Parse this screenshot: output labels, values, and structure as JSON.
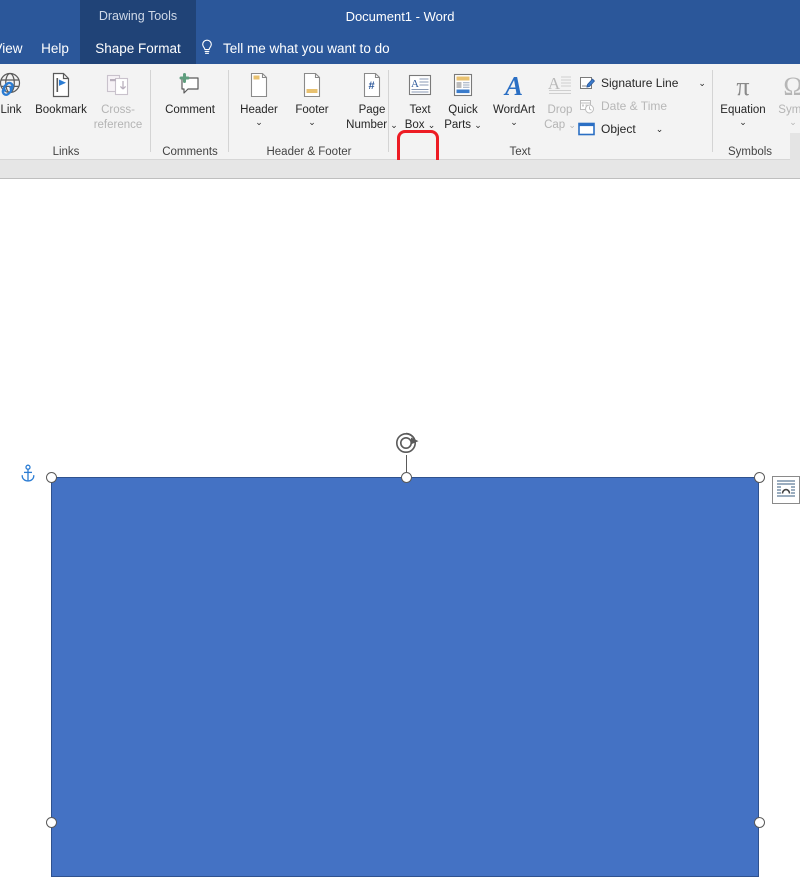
{
  "window": {
    "title": "Document1  -  Word",
    "contextual_tab_header": "Drawing Tools"
  },
  "tabs": [
    {
      "id": "view",
      "label": "View",
      "active": false
    },
    {
      "id": "help",
      "label": "Help",
      "active": false
    },
    {
      "id": "shape-format",
      "label": "Shape Format",
      "active": true
    }
  ],
  "tell_me": {
    "label": "Tell me what you want to do",
    "icon": "lightbulb-icon"
  },
  "ribbon": {
    "groups": [
      {
        "id": "links",
        "label": "Links",
        "buttons": [
          {
            "id": "link",
            "label": "Link",
            "icon": "globe-link-icon",
            "disabled": false
          },
          {
            "id": "bookmark",
            "label": "Bookmark",
            "icon": "bookmark-flag-icon",
            "disabled": false
          },
          {
            "id": "cross-reference",
            "label": "Cross-",
            "label2": "reference",
            "icon": "cross-reference-icon",
            "disabled": true
          }
        ]
      },
      {
        "id": "comments",
        "label": "Comments",
        "buttons": [
          {
            "id": "comment",
            "label": "Comment",
            "icon": "new-comment-icon",
            "disabled": false
          }
        ]
      },
      {
        "id": "header-footer",
        "label": "Header & Footer",
        "buttons": [
          {
            "id": "header",
            "label": "Header",
            "icon": "header-page-icon",
            "dropdown": true
          },
          {
            "id": "footer",
            "label": "Footer",
            "icon": "footer-page-icon",
            "dropdown": true
          },
          {
            "id": "page-number",
            "label": "Page",
            "label2": "Number",
            "icon": "page-number-icon",
            "dropdown": true
          }
        ]
      },
      {
        "id": "text",
        "label": "Text",
        "highlighted_button": "text-box",
        "buttons": [
          {
            "id": "text-box",
            "label": "Text",
            "label2": "Box",
            "icon": "text-box-icon",
            "dropdown": true,
            "selected": true
          },
          {
            "id": "quick-parts",
            "label": "Quick",
            "label2": "Parts",
            "icon": "quick-parts-icon",
            "dropdown": true
          },
          {
            "id": "wordart",
            "label": "WordArt",
            "icon": "wordart-icon",
            "dropdown": true
          },
          {
            "id": "drop-cap",
            "label": "Drop",
            "label2": "Cap",
            "icon": "drop-cap-icon",
            "dropdown": true,
            "disabled": true
          }
        ],
        "small_buttons": [
          {
            "id": "signature-line",
            "label": "Signature Line",
            "icon": "signature-line-icon",
            "dropdown": true,
            "disabled": false
          },
          {
            "id": "date-time",
            "label": "Date & Time",
            "icon": "date-time-icon",
            "dropdown": false,
            "disabled": true
          },
          {
            "id": "object",
            "label": "Object",
            "icon": "object-icon",
            "dropdown": true,
            "disabled": false
          }
        ]
      },
      {
        "id": "symbols",
        "label": "Symbols",
        "buttons": [
          {
            "id": "equation",
            "label": "Equation",
            "icon": "pi-icon",
            "dropdown": true,
            "disabled": false
          },
          {
            "id": "symbol",
            "label": "Symb",
            "icon": "omega-icon",
            "dropdown": true,
            "disabled": true
          }
        ]
      }
    ]
  },
  "canvas": {
    "shape": {
      "name": "rectangle-shape",
      "fill_color": "#4472C4",
      "outline_color": "#2F528F",
      "selected": true
    },
    "anchor_icon": "anchor-icon",
    "rotation_handle": "rotate-handle",
    "layout_options_button": "layout-options-icon",
    "handles": [
      "top-left",
      "top-middle",
      "top-right",
      "middle-left",
      "middle-right"
    ]
  },
  "colors": {
    "titlebar": "#2B579A",
    "titlebar_dark": "#204377",
    "ribbon_bg": "#F3F3F3",
    "highlight_red": "#ED1C24",
    "shape_blue": "#4472C4",
    "accent_blue": "#2B579A"
  }
}
